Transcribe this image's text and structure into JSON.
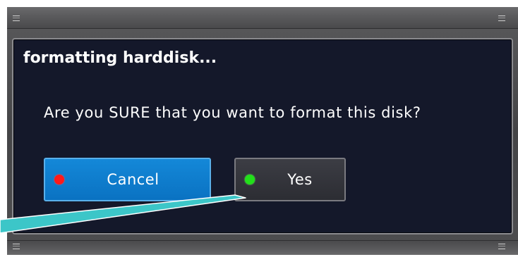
{
  "dialog": {
    "title": "formatting harddisk...",
    "message": "Are you SURE that you want to format this disk?",
    "buttons": {
      "cancel": {
        "label": "Cancel",
        "indicator_color": "#ff1a1a",
        "state": "highlighted"
      },
      "yes": {
        "label": "Yes",
        "indicator_color": "#22e01a",
        "state": "normal"
      }
    }
  },
  "colors": {
    "panel_background": "#14182a",
    "cancel_background": "#0a78c8",
    "yes_background": "#34353c",
    "callout_pointer": "#3cc6c8"
  },
  "icons": {
    "cancel_indicator": "red-dot-icon",
    "yes_indicator": "green-dot-icon",
    "callout": "callout-pointer"
  }
}
